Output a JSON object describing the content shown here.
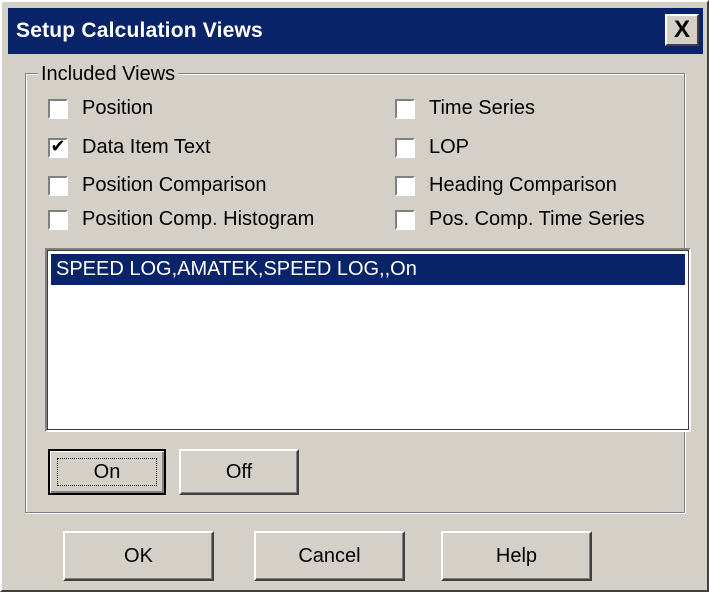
{
  "window": {
    "title": "Setup Calculation Views",
    "close_glyph": "X"
  },
  "group": {
    "label": "Included Views"
  },
  "checkboxes": [
    {
      "label": "Position",
      "checked": false
    },
    {
      "label": "Time Series",
      "checked": false
    },
    {
      "label": "Data Item Text",
      "checked": true
    },
    {
      "label": "LOP",
      "checked": false
    },
    {
      "label": "Position Comparison",
      "checked": false
    },
    {
      "label": "Heading Comparison",
      "checked": false
    },
    {
      "label": "Position Comp. Histogram",
      "checked": false
    },
    {
      "label": "Pos. Comp. Time Series",
      "checked": false
    }
  ],
  "list": {
    "items": [
      {
        "text": "SPEED LOG,AMATEK,SPEED LOG,,On",
        "selected": true
      }
    ]
  },
  "toggle_buttons": {
    "on_label": "On",
    "off_label": "Off"
  },
  "footer": {
    "ok_label": "OK",
    "cancel_label": "Cancel",
    "help_label": "Help"
  },
  "colors": {
    "face": "#d4d0c8",
    "title_bar": "#0a246a",
    "selection": "#0a246a"
  }
}
